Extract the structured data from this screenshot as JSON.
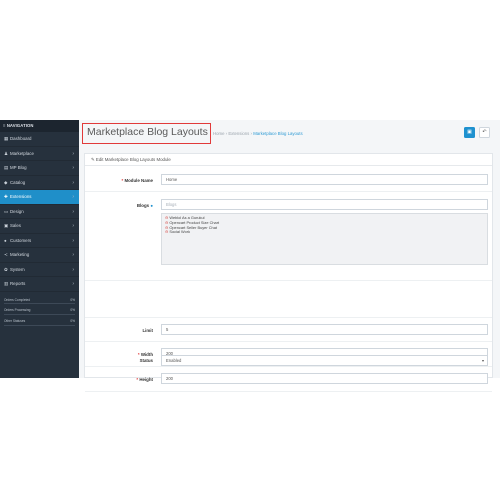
{
  "sidebar": {
    "header": "NAVIGATION",
    "items": [
      {
        "label": "Dashboard",
        "icon": "dashboard-icon",
        "glyph": "▦",
        "chevron": ""
      },
      {
        "label": "Marketplace",
        "icon": "users-icon",
        "glyph": "♟",
        "chevron": "›"
      },
      {
        "label": "MP Blog",
        "icon": "book-icon",
        "glyph": "▤",
        "chevron": "›"
      },
      {
        "label": "Catalog",
        "icon": "tag-icon",
        "glyph": "◆",
        "chevron": "›"
      },
      {
        "label": "Extensions",
        "icon": "puzzle-icon",
        "glyph": "✚",
        "chevron": "›",
        "active": true
      },
      {
        "label": "Design",
        "icon": "monitor-icon",
        "glyph": "▭",
        "chevron": "›"
      },
      {
        "label": "Sales",
        "icon": "cart-icon",
        "glyph": "▣",
        "chevron": "›"
      },
      {
        "label": "Customers",
        "icon": "user-icon",
        "glyph": "●",
        "chevron": "›"
      },
      {
        "label": "Marketing",
        "icon": "share-icon",
        "glyph": "≺",
        "chevron": "›"
      },
      {
        "label": "System",
        "icon": "cog-icon",
        "glyph": "✿",
        "chevron": "›"
      },
      {
        "label": "Reports",
        "icon": "bar-chart-icon",
        "glyph": "▥",
        "chevron": "›"
      }
    ],
    "stats": [
      {
        "label": "Orders Completed",
        "value": "0%",
        "fill": 0.0
      },
      {
        "label": "Orders Processing",
        "value": "0%",
        "fill": 0.0
      },
      {
        "label": "Other Statuses",
        "value": "0%",
        "fill": 0.0
      }
    ]
  },
  "header": {
    "title": "Marketplace Blog Layouts",
    "breadcrumbs": [
      "Home",
      "Extensions",
      "Marketplace Blog Layouts"
    ],
    "separator": "›",
    "save_glyph": "▣",
    "back_glyph": "↶"
  },
  "panel": {
    "heading": "Edit Marketplace Blog Layouts Module",
    "fields": {
      "module_name": {
        "label": "Module Name",
        "value": "Home"
      },
      "blogs": {
        "label": "Blogs",
        "placeholder": "Blogs",
        "items": [
          "Weblol As a Gurukul",
          "Opencart Product Size Chart",
          "Opencart Seller Buyer Chat",
          "Social Work"
        ]
      },
      "limit": {
        "label": "Limit",
        "value": "5"
      },
      "width": {
        "label": "Width",
        "value": "200"
      },
      "height": {
        "label": "Height",
        "value": "200"
      },
      "status": {
        "label": "Status",
        "value": "Enabled"
      }
    }
  },
  "colors": {
    "sidebar_bg": "#26313d",
    "active_item": "#1f8fc9",
    "title_highlight": "#e13a3a",
    "primary_button": "#1e91cf"
  }
}
